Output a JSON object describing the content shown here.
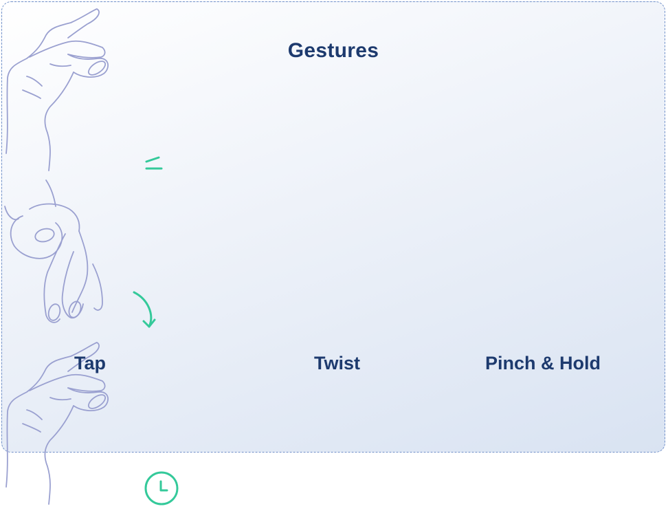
{
  "title": "Gestures",
  "gestures": [
    {
      "label": "Tap",
      "icon": "tap-hand-icon",
      "indicator": "tap-lines-icon"
    },
    {
      "label": "Twist",
      "icon": "twist-hand-icon",
      "indicator": "curved-arrow-icon"
    },
    {
      "label": "Pinch & Hold",
      "icon": "pinch-hand-icon",
      "indicator": "clock-icon"
    }
  ],
  "colors": {
    "title": "#1d3a6e",
    "label": "#1d3a6e",
    "hand_outline": "#9aa0d0",
    "accent": "#34c99a",
    "border": "#6f8fc9"
  }
}
